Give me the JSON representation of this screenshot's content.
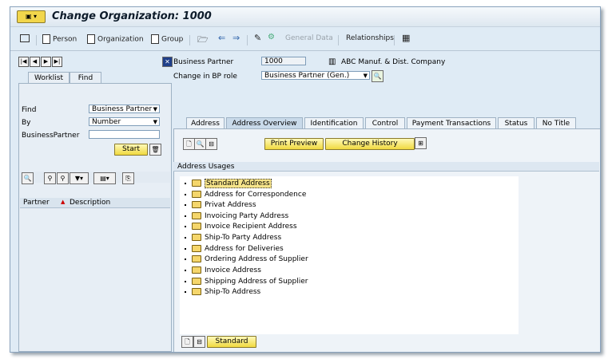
{
  "window": {
    "title": "Change Organization: 1000"
  },
  "toolbar": {
    "person": "Person",
    "organization": "Organization",
    "group": "Group",
    "general_data": "General Data",
    "relationships": "Relationships"
  },
  "navigator": {
    "tabs": [
      "Worklist",
      "Find"
    ],
    "find_label": "Find",
    "find_value": "Business Partner",
    "by_label": "By",
    "by_value": "Number",
    "bp_label": "BusinessPartner",
    "bp_value": "",
    "start_label": "Start",
    "columns": [
      "Partner",
      "Description"
    ]
  },
  "header": {
    "bp_label": "Business Partner",
    "bp_number": "1000",
    "bp_name": "ABC Manuf. & Dist. Company",
    "role_label": "Change in BP role",
    "role_value": "Business Partner (Gen.)"
  },
  "tabs": [
    "Address",
    "Address Overview",
    "Identification",
    "Control",
    "Payment Transactions",
    "Status",
    "No Title"
  ],
  "active_tab": "Address Overview",
  "actions": {
    "print_preview": "Print Preview",
    "change_history": "Change History"
  },
  "usages": {
    "title": "Address Usages",
    "items": [
      "Standard Address",
      "Address for Correspondence",
      "Privat Address",
      "Invoicing Party Address",
      "Invoice Recipient Address",
      "Ship-To Party Address",
      "Address for Deliveries",
      "Ordering Address of Supplier",
      "Invoice Address",
      "Shipping Address of Supplier",
      "Ship-To Address"
    ],
    "selected": "Standard Address",
    "standard_button": "Standard"
  },
  "colors": {
    "accent_button": "#f0d93f",
    "window_bg": "#dfebf5",
    "active_tab": "#c9daea"
  }
}
